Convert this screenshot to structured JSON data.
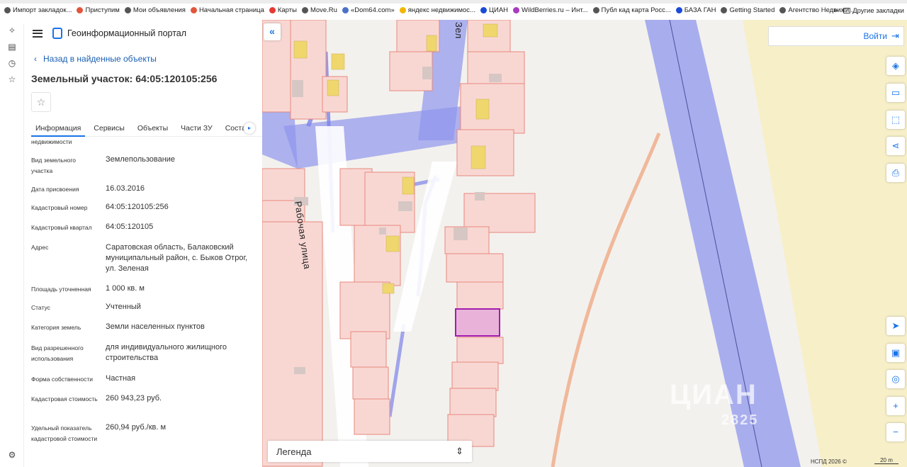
{
  "bookmarks": [
    {
      "label": "Импорт закладок...",
      "color": "#555"
    },
    {
      "label": "Приступим",
      "color": "#e2553b"
    },
    {
      "label": "Мои объявления",
      "color": "#555"
    },
    {
      "label": "Начальная страница",
      "color": "#e2553b"
    },
    {
      "label": "Карты",
      "color": "#e53935"
    },
    {
      "label": "Move.Ru",
      "color": "#555"
    },
    {
      "label": "«Dom64.com»",
      "color": "#4a72c8"
    },
    {
      "label": "яндекс недвижимос...",
      "color": "#f2b600"
    },
    {
      "label": "ЦИАН",
      "color": "#1a4bd8"
    },
    {
      "label": "WildBerries.ru – Инт...",
      "color": "#a83cbf"
    },
    {
      "label": "Публ кад карта Росс...",
      "color": "#555"
    },
    {
      "label": "БАЗА ГАН",
      "color": "#1a4bd8"
    },
    {
      "label": "Getting Started",
      "color": "#555"
    },
    {
      "label": "Агентство Недвижи...",
      "color": "#555"
    }
  ],
  "bookmarks_more": "»",
  "other_bookmarks": "Другие закладки",
  "portal_title": "Геоинформационный портал",
  "back_link": "Назад в найденные объекты",
  "object_title": "Земельный участок: 64:05:120105:256",
  "tabs": [
    "Информация",
    "Сервисы",
    "Объекты",
    "Части ЗУ",
    "Соста"
  ],
  "partial_label": "недвижимости",
  "rows": [
    {
      "label": "Вид земельного участка",
      "value": "Землепользование"
    },
    {
      "label": "Дата присвоения",
      "value": "16.03.2016"
    },
    {
      "label": "Кадастровый номер",
      "value": "64:05:120105:256"
    },
    {
      "label": "Кадастровый квартал",
      "value": "64:05:120105"
    },
    {
      "label": "Адрес",
      "value": "Саратовская область, Балаковский муниципальный район, с. Быков Отрог, ул. Зеленая"
    },
    {
      "label": "Площадь уточненная",
      "value": "1 000 кв. м"
    },
    {
      "label": "Статус",
      "value": "Учтенный"
    },
    {
      "label": "Категория земель",
      "value": "Земли населенных пунктов"
    },
    {
      "label": "Вид разрешенного использования",
      "value": "для индивидуального жилищного строительства"
    },
    {
      "label": "Форма собственности",
      "value": "Частная"
    },
    {
      "label": "Кадастровая стоимость",
      "value": "260 943,23 руб."
    },
    {
      "label": "Удельный показатель кадастровой стоимости",
      "value": "260,94 руб./кв. м"
    }
  ],
  "login_label": "Войти",
  "legend_label": "Легенда",
  "streets": {
    "rabochaya": "Рабочая улица",
    "zelenaya": "Зел"
  },
  "attribution": "НСПД 2026 ©",
  "scale_label": "20 m",
  "watermark": "ЦИАН",
  "watermark_num": "2825",
  "colors": {
    "accent": "#1a73e8",
    "parcel_fill": "#f8d7d3",
    "parcel_stroke": "#e8887c",
    "selected": "#a21caf",
    "road_blue": "#7c83e8",
    "sand": "#f7efc8"
  }
}
